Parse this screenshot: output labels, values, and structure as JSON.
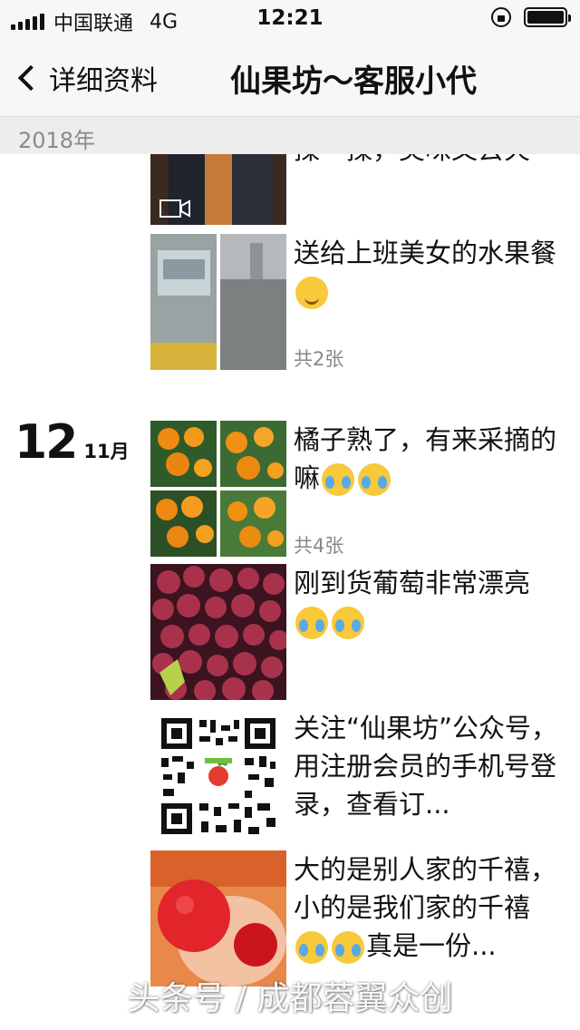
{
  "status_bar": {
    "carrier": "中国联通",
    "network": "4G",
    "time": "12:21"
  },
  "nav": {
    "back_label": "详细资料",
    "title": "仙果坊～客服小代"
  },
  "year_header": "2018年",
  "date_group": {
    "day": "12",
    "month": "11月"
  },
  "posts": [
    {
      "text": "揉一揉，美味又去火",
      "icon": "video-icon"
    },
    {
      "text": "送给上班美女的水果餐",
      "count": "共2张",
      "emoji": "smile-emoji"
    },
    {
      "text": "橘子熟了，有来采摘的嘛",
      "count": "共4张",
      "emoji": "cry-laugh-emoji"
    },
    {
      "text": "刚到货葡萄非常漂亮",
      "emoji": "tears-of-joy-emoji"
    },
    {
      "text": "关注“仙果坊”公众号，用注册会员的手机号登录，查看订..."
    },
    {
      "text_a": "大的是别人家的千禧，小的是我们家的千禧",
      "text_b": "真是一份..."
    }
  ],
  "watermark": "头条号 / 成都蓉翼众创",
  "colors": {
    "bar_bg": "#f7f7f7",
    "year_bg": "#ededed",
    "muted_text": "#888888"
  }
}
